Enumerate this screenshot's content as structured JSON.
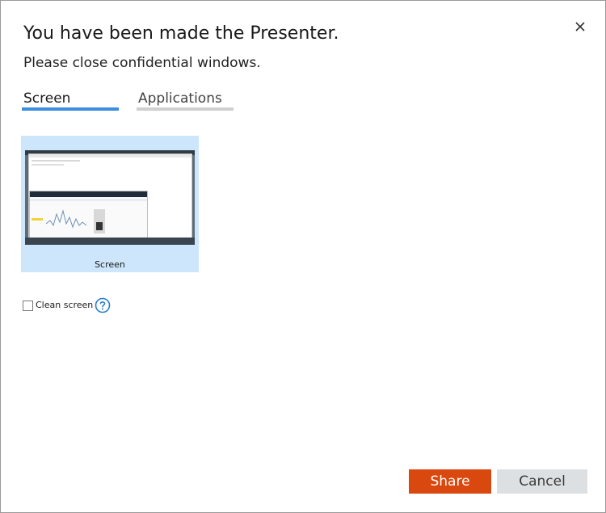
{
  "dialog": {
    "title": "You have been made the Presenter.",
    "subtitle": "Please close confidential windows.",
    "close_icon": "close-icon"
  },
  "tabs": [
    {
      "label": "Screen",
      "selected": true
    },
    {
      "label": "Applications",
      "selected": false
    }
  ],
  "screen_card": {
    "label": "Screen",
    "selected": true
  },
  "options": {
    "clean_screen_label": "Clean screen",
    "clean_screen_checked": false,
    "help_icon": "help-circle-icon"
  },
  "actions": {
    "share_label": "Share",
    "cancel_label": "Cancel"
  },
  "colors": {
    "accent_blue": "#3b8ee0",
    "selection_bg": "#cde6fb",
    "share_button": "#d9480f",
    "cancel_button": "#dde0e3",
    "help_icon": "#2a7ec8"
  }
}
